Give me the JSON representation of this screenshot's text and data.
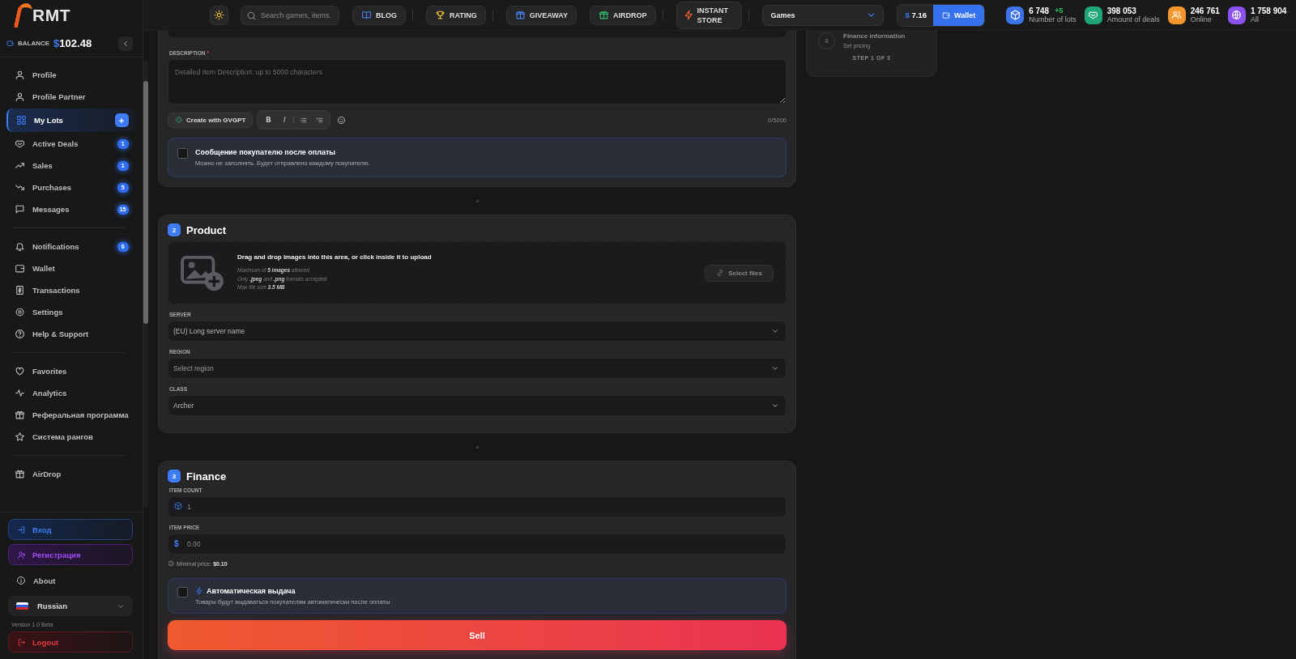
{
  "logo": {
    "text": "RMT"
  },
  "balance": {
    "label": "BALANCE",
    "currency": "$",
    "amount": "102.48"
  },
  "nav_groups": [
    {
      "items": [
        {
          "label": "Profile",
          "selected": false
        },
        {
          "label": "Profile Partner",
          "selected": false
        },
        {
          "label": "My Lots",
          "selected": true,
          "add_button": true
        },
        {
          "label": "Active Deals",
          "selected": false,
          "badge": "1"
        },
        {
          "label": "Sales",
          "selected": false,
          "badge": "1"
        },
        {
          "label": "Purchases",
          "selected": false,
          "badge": "5"
        },
        {
          "label": "Messages",
          "selected": false,
          "badge": "15"
        }
      ]
    },
    {
      "items": [
        {
          "label": "Notifications",
          "selected": false,
          "badge": "6"
        },
        {
          "label": "Wallet",
          "selected": false
        },
        {
          "label": "Transactions",
          "selected": false
        },
        {
          "label": "Settings",
          "selected": false
        },
        {
          "label": "Help & Support",
          "selected": false
        }
      ]
    },
    {
      "items": [
        {
          "label": "Favorites",
          "selected": false
        },
        {
          "label": "Analytics",
          "selected": false
        },
        {
          "label": "Реферальная программа",
          "selected": false
        },
        {
          "label": "Система рангов",
          "selected": false
        }
      ]
    },
    {
      "items": [
        {
          "label": "AirDrop",
          "selected": false
        }
      ]
    }
  ],
  "auth_buttons": [
    {
      "label": "Вход",
      "kind": "login"
    },
    {
      "label": "Регистрация",
      "kind": "register"
    }
  ],
  "about": "About",
  "language": {
    "label": "Russian"
  },
  "version": "Version 1.0 Beta",
  "logout": "Logout",
  "topbar": {
    "search_placeholder": "Search games, items.",
    "links": [
      {
        "label": "BLOG",
        "kind": "blog"
      },
      {
        "label": "RATING",
        "kind": "rating"
      },
      {
        "label": "GIVEAWAY",
        "kind": "giveaway"
      },
      {
        "label": "AIRDROP",
        "kind": "airdrop"
      }
    ],
    "instant_store": "INSTANT STORE",
    "category": "Games",
    "wallet": {
      "currency": "$",
      "amount": "7.16",
      "button": "Wallet"
    },
    "stats": [
      {
        "value": "6 748",
        "delta": "+5",
        "label": "Number of lots",
        "color": "#3d73ea"
      },
      {
        "value": "398 053",
        "label": "Amount of deals",
        "color": "#1fa577"
      },
      {
        "value": "246 761",
        "label": "Online",
        "color": "#f2962c"
      },
      {
        "value": "1 758 904",
        "label": "All",
        "color": "#8b52f0"
      }
    ]
  },
  "description": {
    "label": "DESCRIPTION",
    "required_mark": "*",
    "placeholder": "Detailed Item Description: up to 5000 characters",
    "ai_button": "Create with GVGPT",
    "format_buttons": [
      "B",
      "I"
    ],
    "counter": "0/5000",
    "buyer_message": {
      "checked": false,
      "title": "Сообщение покупателю после оплаты",
      "hint": "Можно не заполнять. Будет отправлено каждому покупателю."
    }
  },
  "product": {
    "number": "2",
    "title": "Product",
    "upload": {
      "title": "Drag and drop images into this area, or click inside it to upload",
      "hints": [
        "Maximum of **5 images** allowed",
        "Only **.jpeg** and **.png** formats accepted",
        "Max file size **3.5 MB**"
      ],
      "button": "Select files"
    },
    "selects": [
      {
        "label": "SERVER",
        "value": "(EU) Long server name"
      },
      {
        "label": "REGION",
        "placeholder": "Select region"
      },
      {
        "label": "CLASS",
        "value": "Archer"
      }
    ]
  },
  "finance": {
    "number": "3",
    "title": "Finance",
    "fields": [
      {
        "label": "ITEM COUNT",
        "kind": "count",
        "placeholder": "1"
      },
      {
        "label": "ITEM PRICE",
        "kind": "price",
        "prefix": "$",
        "placeholder": "0.00"
      }
    ],
    "min_price": "Minimal price: **$0.10**",
    "auto_delivery": {
      "checked": false,
      "title": "Автоматическая выдача",
      "hint": "Товары будут выдаваться покупателям автоматически после оплаты"
    },
    "submit": "Sell"
  },
  "stepper": {
    "number": "3",
    "title": "Finance information",
    "subtitle": "Set pricing",
    "progress": "STEP 1 OF 3"
  }
}
